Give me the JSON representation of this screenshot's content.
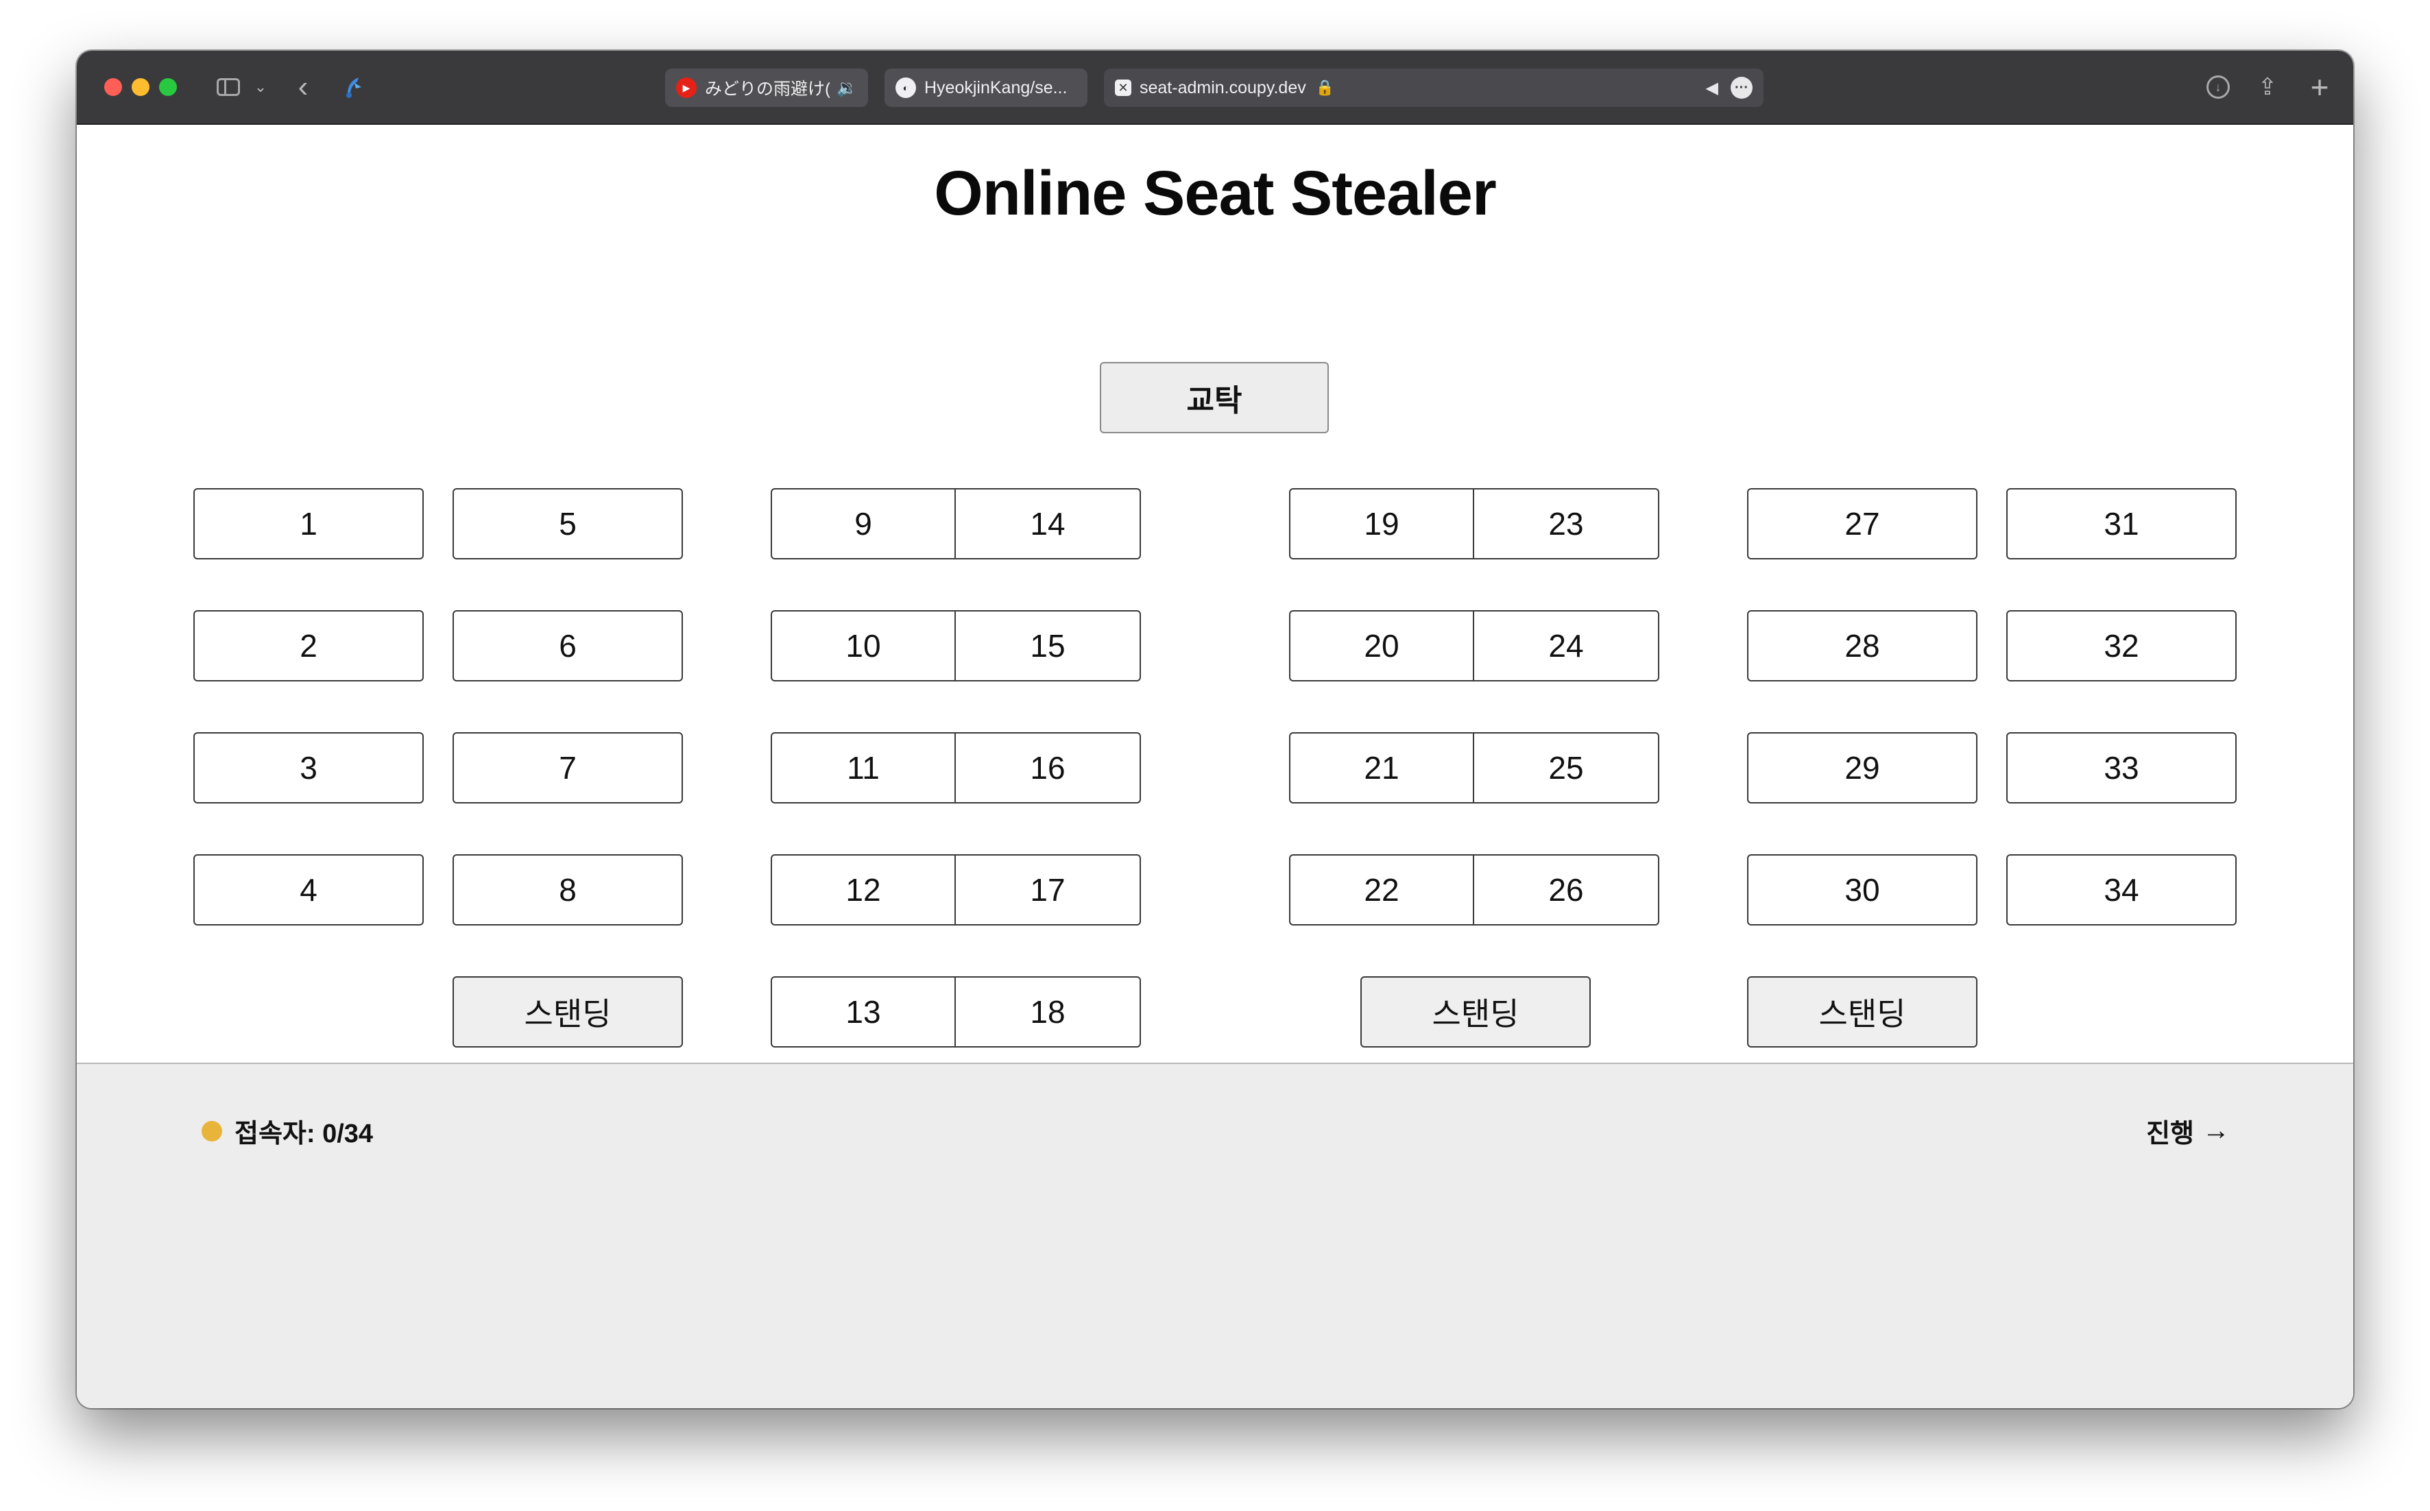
{
  "browser": {
    "tabs": [
      {
        "title": "みどりの雨避け(...",
        "favicon": "youtube-icon",
        "audio": true
      },
      {
        "title": "HyeokjinKang/se...",
        "favicon": "github-icon"
      },
      {
        "title": "seat-admin.coupy.dev",
        "favicon": "close-box-icon",
        "secure": true
      }
    ],
    "favicon_glyphs": {
      "youtube": "▶",
      "github": "◐",
      "close": "✕"
    },
    "icons": {
      "back": "‹",
      "chevron": "⌄",
      "audio": "🔉",
      "lock": "🔒",
      "speaker": "◀",
      "more": "···",
      "download": "↓",
      "share": "⇪",
      "new_tab": "+"
    }
  },
  "page": {
    "title": "Online Seat Stealer",
    "podium_label": "교탁",
    "seats": [
      "1",
      "2",
      "3",
      "4",
      "5",
      "6",
      "7",
      "8",
      "9",
      "10",
      "11",
      "12",
      "13",
      "14",
      "15",
      "16",
      "17",
      "18",
      "19",
      "20",
      "21",
      "22",
      "23",
      "24",
      "25",
      "26",
      "27",
      "28",
      "29",
      "30",
      "31",
      "32",
      "33",
      "34"
    ],
    "standing_label": "스탠딩"
  },
  "footer": {
    "status_text": "접속자: 0/34",
    "status_color": "#e8b43a",
    "proceed_label": "진행",
    "proceed_arrow": "→"
  }
}
